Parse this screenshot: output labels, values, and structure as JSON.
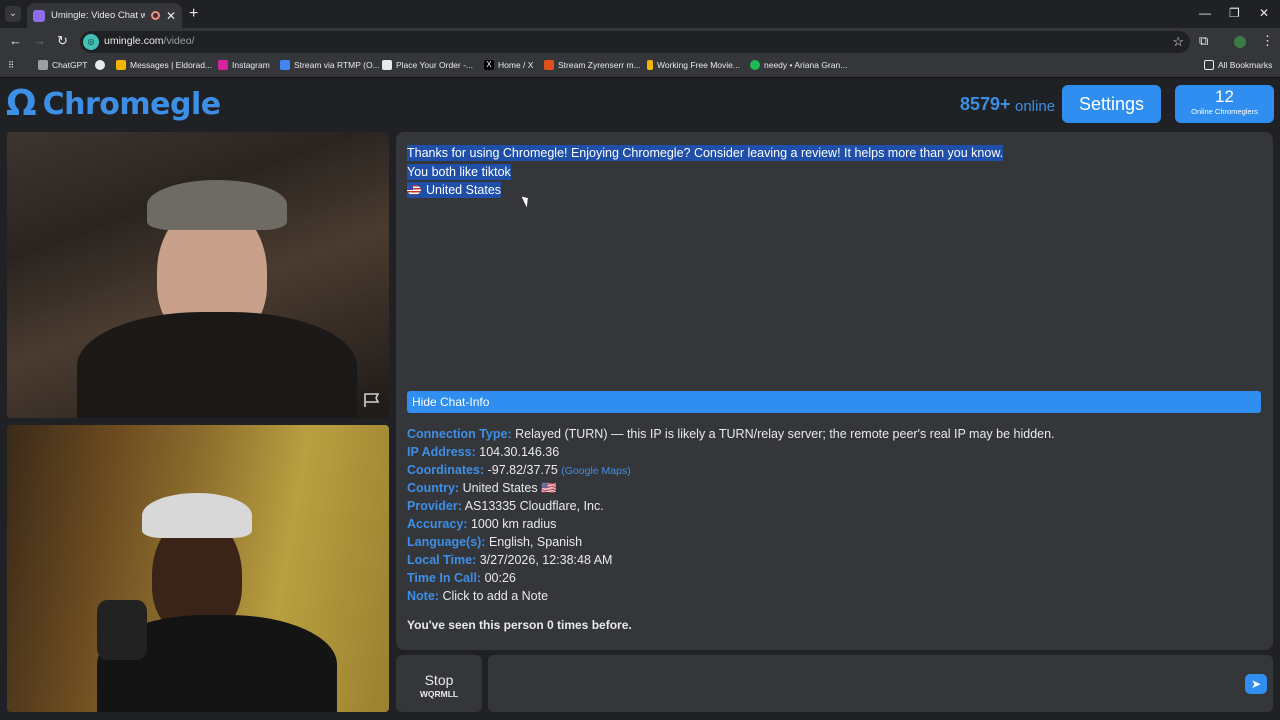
{
  "browser": {
    "tab_title": "Umingle: Video Chat with S",
    "url_host": "umingle.com",
    "url_path": "/video/",
    "bookmarks": [
      {
        "label": "ChatGPT",
        "color": "#9aa0a6"
      },
      {
        "label": "",
        "color": "#e8eaed"
      },
      {
        "label": "Messages | Eldorad...",
        "color": "#f4b400"
      },
      {
        "label": "Instagram",
        "color": "#d6249f"
      },
      {
        "label": "Stream via RTMP (O...",
        "color": "#4285f4"
      },
      {
        "label": "Place Your Order -...",
        "color": "#e8eaed"
      },
      {
        "label": "Home / X",
        "color": "#000000"
      },
      {
        "label": "Stream Zyrenserr m...",
        "color": "#e0501c"
      },
      {
        "label": "Working Free Movie...",
        "color": "#f4b400"
      },
      {
        "label": "needy • Ariana Gran...",
        "color": "#1db954"
      }
    ],
    "all_bookmarks": "All Bookmarks"
  },
  "header": {
    "logo_symbol": "Ω",
    "logo_text": "Chromegle",
    "online_count": "8579+",
    "online_label": "online",
    "settings_label": "Settings",
    "chromeglers_count": "12",
    "chromeglers_label": "Online Chromeglers"
  },
  "chat": {
    "messages": [
      "Thanks for using Chromegle! Enjoying Chromegle? Consider leaving a review! It helps more than you know.",
      "You both like tiktok",
      "United States"
    ],
    "hide_chat_info": "Hide Chat-Info"
  },
  "chat_info": {
    "connection_type": {
      "key": "Connection Type:",
      "value": "Relayed (TURN) — this IP is likely a TURN/relay server; the remote peer's real IP may be hidden."
    },
    "ip_address": {
      "key": "IP Address:",
      "value": "104.30.146.36"
    },
    "coordinates": {
      "key": "Coordinates:",
      "value": "-97.82/37.75",
      "link": "(Google Maps)"
    },
    "country": {
      "key": "Country:",
      "value": "United States 🇺🇸"
    },
    "provider": {
      "key": "Provider:",
      "value": "AS13335 Cloudflare, Inc."
    },
    "accuracy": {
      "key": "Accuracy:",
      "value": "1000 km radius"
    },
    "languages": {
      "key": "Language(s):",
      "value": "English, Spanish"
    },
    "local_time": {
      "key": "Local Time:",
      "value": "3/27/2026, 12:38:48 AM"
    },
    "time_in_call": {
      "key": "Time In Call:",
      "value": "00:26"
    },
    "note": {
      "key": "Note:",
      "value": "Click to add a Note"
    },
    "seen": "You've seen this person 0 times before."
  },
  "controls": {
    "stop_label": "Stop",
    "stop_code": "WQRMLL",
    "message_placeholder": ""
  }
}
